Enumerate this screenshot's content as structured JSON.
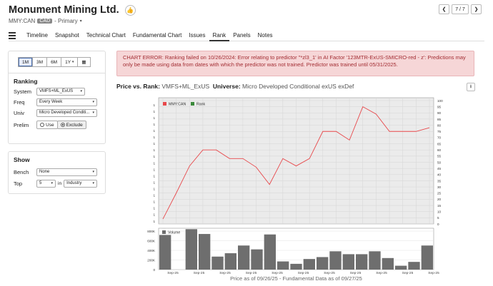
{
  "header": {
    "company": "Monument Mining Ltd.",
    "ticker": "MMY:CAN",
    "currency": "CAD",
    "listing": "- Primary",
    "thumb_icon": "thumbs-up-icon",
    "pager_label": "7 / 7"
  },
  "tabs": [
    "Timeline",
    "Snapshot",
    "Technical Chart",
    "Fundamental Chart",
    "Issues",
    "Rank",
    "Panels",
    "Notes"
  ],
  "active_tab": "Rank",
  "periods": [
    "1M",
    "3M",
    "6M",
    "1Y"
  ],
  "selected_period": "1M",
  "ranking": {
    "title": "Ranking",
    "system_label": "System",
    "system_value": "VMFS+ML_ExUS",
    "freq_label": "Freq",
    "freq_value": "Every Week",
    "univ_label": "Univ",
    "univ_value": "Micro Developed Conditi...",
    "prelim_label": "Prelim",
    "use_label": "Use",
    "exclude_label": "Exclude"
  },
  "show": {
    "title": "Show",
    "bench_label": "Bench",
    "bench_value": "None",
    "top_label": "Top",
    "top_value": "5",
    "in_label": "in",
    "group_value": "Industry"
  },
  "error": {
    "text": "CHART ERROR: Ranking failed on 10/26/2024: Error relating to predictor \"*zl3_1' in AI Factor '123MTR-ExUS-SMICRO-red - z': Predictions may only be made using data from dates with which the predictor was not trained. Predictor was trained until 05/31/2025."
  },
  "chart_header": {
    "label": "Price vs. Rank:",
    "system": "VMFS+ML_ExUS",
    "universe_label": "Universe:",
    "universe": "Micro Developed Conditional exUS exDef"
  },
  "footer": "Price as of 09/26/25 - Fundamental Data as of 09/27/25",
  "chart_data": [
    {
      "type": "line",
      "legend": [
        "MMY:CAN",
        "Rank"
      ],
      "colors": {
        "price": "#e8484b",
        "rank": "#3a8a3a"
      },
      "left_tick_labels": [
        "1",
        "1",
        "1",
        "1",
        "1",
        "1",
        "1",
        "1",
        "1",
        "1",
        "1",
        "1",
        "1",
        "1",
        "1",
        "1",
        "1",
        "1",
        "1"
      ],
      "right_ylim": [
        0,
        100
      ],
      "right_ticks": [
        0,
        5,
        10,
        15,
        20,
        25,
        30,
        35,
        40,
        45,
        50,
        55,
        60,
        65,
        70,
        75,
        80,
        85,
        90,
        95,
        100
      ],
      "price_values": [
        4,
        25,
        47,
        60,
        60,
        53,
        53,
        46,
        32,
        53,
        47,
        53,
        75,
        75,
        68,
        95,
        89,
        75,
        75,
        75,
        78
      ],
      "grid": true,
      "legend_position": "top-left"
    },
    {
      "type": "bar",
      "legend": [
        "Volume"
      ],
      "ylim": [
        0,
        800000
      ],
      "y_tick_labels": [
        "0",
        "200K",
        "400K",
        "600K",
        "800K"
      ],
      "x_tick_labels": [
        "Sep-25",
        "Sep-25",
        "Sep-25",
        "Sep-25",
        "Sep-25",
        "Sep-25",
        "Sep-25",
        "Sep-25",
        "Sep-25",
        "Sep-25",
        "Sep-25"
      ],
      "values": [
        720000,
        0,
        840000,
        740000,
        270000,
        340000,
        500000,
        420000,
        730000,
        170000,
        120000,
        220000,
        260000,
        380000,
        320000,
        320000,
        380000,
        240000,
        80000,
        160000,
        500000
      ]
    }
  ]
}
